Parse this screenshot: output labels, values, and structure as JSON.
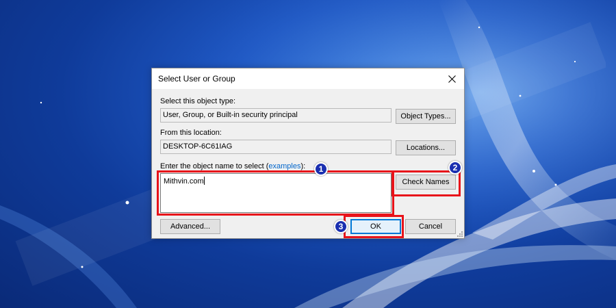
{
  "dialog": {
    "title": "Select User or Group",
    "object_type_label": "Select this object type:",
    "object_type_value": "User, Group, or Built-in security principal",
    "object_types_button": "Object Types...",
    "location_label": "From this location:",
    "location_value": "DESKTOP-6C61IAG",
    "locations_button": "Locations...",
    "enter_name_label_prefix": "Enter the object name to select (",
    "examples_link": "examples",
    "enter_name_label_suffix": "):",
    "object_name_value": "Mithvin.com",
    "check_names_button": "Check Names",
    "advanced_button": "Advanced...",
    "ok_button": "OK",
    "cancel_button": "Cancel"
  },
  "annotations": {
    "step1": "1",
    "step2": "2",
    "step3": "3",
    "highlight_color": "#e8131a",
    "badge_color": "#1a2fb0"
  },
  "icons": {
    "close": "close-icon",
    "resize": "resize-grip-icon"
  }
}
